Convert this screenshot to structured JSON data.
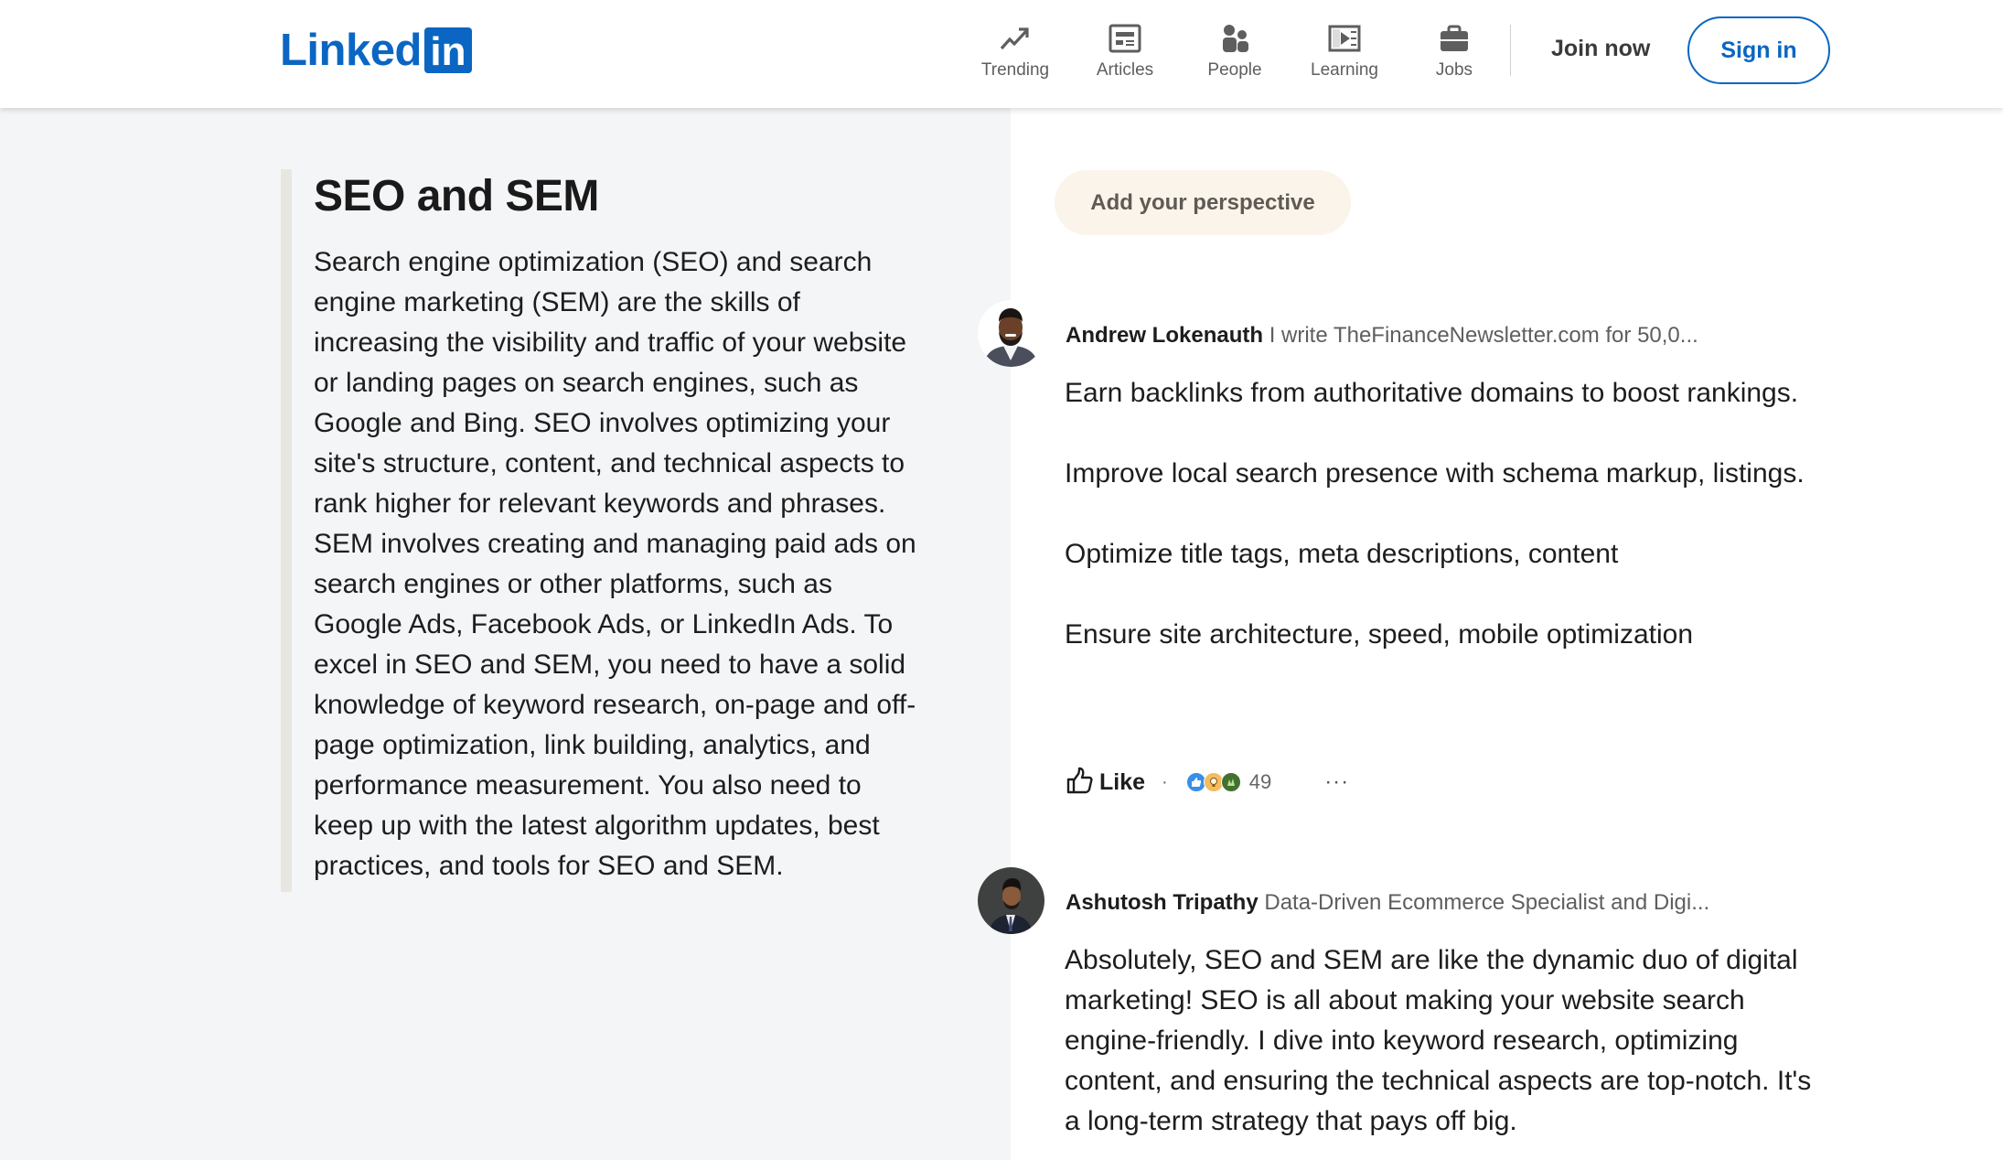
{
  "header": {
    "logo_text": "Linked",
    "logo_badge": "in",
    "brand_color": "#0a66c2",
    "nav": [
      {
        "label": "Trending",
        "icon": "trending-icon"
      },
      {
        "label": "Articles",
        "icon": "articles-icon"
      },
      {
        "label": "People",
        "icon": "people-icon"
      },
      {
        "label": "Learning",
        "icon": "learning-icon"
      },
      {
        "label": "Jobs",
        "icon": "jobs-icon"
      }
    ],
    "join_label": "Join now",
    "signin_label": "Sign in"
  },
  "article": {
    "title": "SEO and SEM",
    "body": "Search engine optimization (SEO) and search engine marketing (SEM) are the skills of increasing the visibility and traffic of your website or landing pages on search engines, such as Google and Bing. SEO involves optimizing your site's structure, content, and technical aspects to rank higher for relevant keywords and phrases. SEM involves creating and managing paid ads on search engines or other platforms, such as Google Ads, Facebook Ads, or LinkedIn Ads. To excel in SEO and SEM, you need to have a solid knowledge of keyword research, on-page and off-page optimization, link building, analytics, and performance measurement. You also need to keep up with the latest algorithm updates, best practices, and tools for SEO and SEM."
  },
  "perspective_button": "Add your perspective",
  "comments": [
    {
      "name": "Andrew Lokenauth",
      "headline": "I write TheFinanceNewsletter.com for 50,0...",
      "paragraphs": [
        "Earn backlinks from authoritative domains to boost rankings.",
        "Improve local search presence with schema markup, listings.",
        "Optimize title tags, meta descriptions, content",
        "Ensure site architecture, speed, mobile optimization"
      ],
      "like_label": "Like",
      "reactions": [
        "like",
        "insightful",
        "celebrate"
      ],
      "reaction_count": "49",
      "more_label": "···"
    },
    {
      "name": "Ashutosh Tripathy",
      "headline": "Data-Driven Ecommerce Specialist and Digi...",
      "paragraphs": [
        "Absolutely, SEO and SEM are like the dynamic duo of digital marketing! SEO is all about making your website search engine-friendly. I dive into keyword research, optimizing content, and ensuring the technical aspects are top-notch. It's a long-term strategy that pays off big."
      ]
    }
  ],
  "dot_separator": "·"
}
